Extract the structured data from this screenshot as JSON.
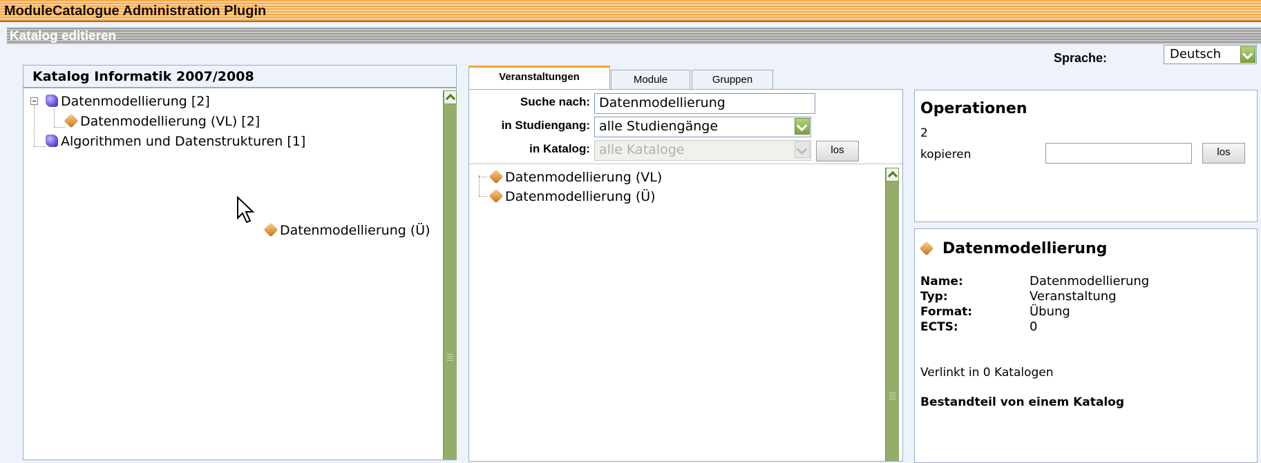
{
  "app": {
    "title": "ModuleCatalogue Administration Plugin",
    "subtitle": "Katalog editieren"
  },
  "language": {
    "label": "Sprache:",
    "selected": "Deutsch"
  },
  "catalog_tree": {
    "title": "Katalog Informatik 2007/2008",
    "nodes": [
      {
        "label": "Datenmodellierung [2]",
        "icon": "puzzle-icon"
      },
      {
        "label": "Datenmodellierung (VL) [2]",
        "icon": "package-icon"
      },
      {
        "label": "Algorithmen und Datenstrukturen [1]",
        "icon": "puzzle-icon"
      }
    ],
    "drag_item": {
      "label": "Datenmodellierung (Ü)",
      "icon": "package-icon"
    }
  },
  "search": {
    "tabs": [
      {
        "label": "Veranstaltungen",
        "active": true
      },
      {
        "label": "Module",
        "active": false
      },
      {
        "label": "Gruppen",
        "active": false
      }
    ],
    "query_label": "Suche nach:",
    "query_value": "Datenmodellierung",
    "program_label": "in Studiengang:",
    "program_value": "alle Studiengänge",
    "catalog_label": "in Katalog:",
    "catalog_value": "alle Kataloge",
    "go_label": "los",
    "results": [
      {
        "label": "Datenmodellierung (VL)",
        "icon": "package-icon"
      },
      {
        "label": "Datenmodellierung (Ü)",
        "icon": "package-icon"
      }
    ]
  },
  "operations": {
    "title": "Operationen",
    "count": "2",
    "copy_label": "kopieren",
    "copy_value": "",
    "go_label": "los"
  },
  "details": {
    "title": "Datenmodellierung",
    "icon": "package-icon",
    "fields": [
      {
        "key": "Name:",
        "value": "Datenmodellierung"
      },
      {
        "key": "Typ:",
        "value": "Veranstaltung"
      },
      {
        "key": "Format:",
        "value": "Übung"
      },
      {
        "key": "ECTS:",
        "value": "0"
      }
    ],
    "linked": "Verlinkt in 0 Katalogen",
    "part_of": "Bestandteil von einem Katalog"
  }
}
